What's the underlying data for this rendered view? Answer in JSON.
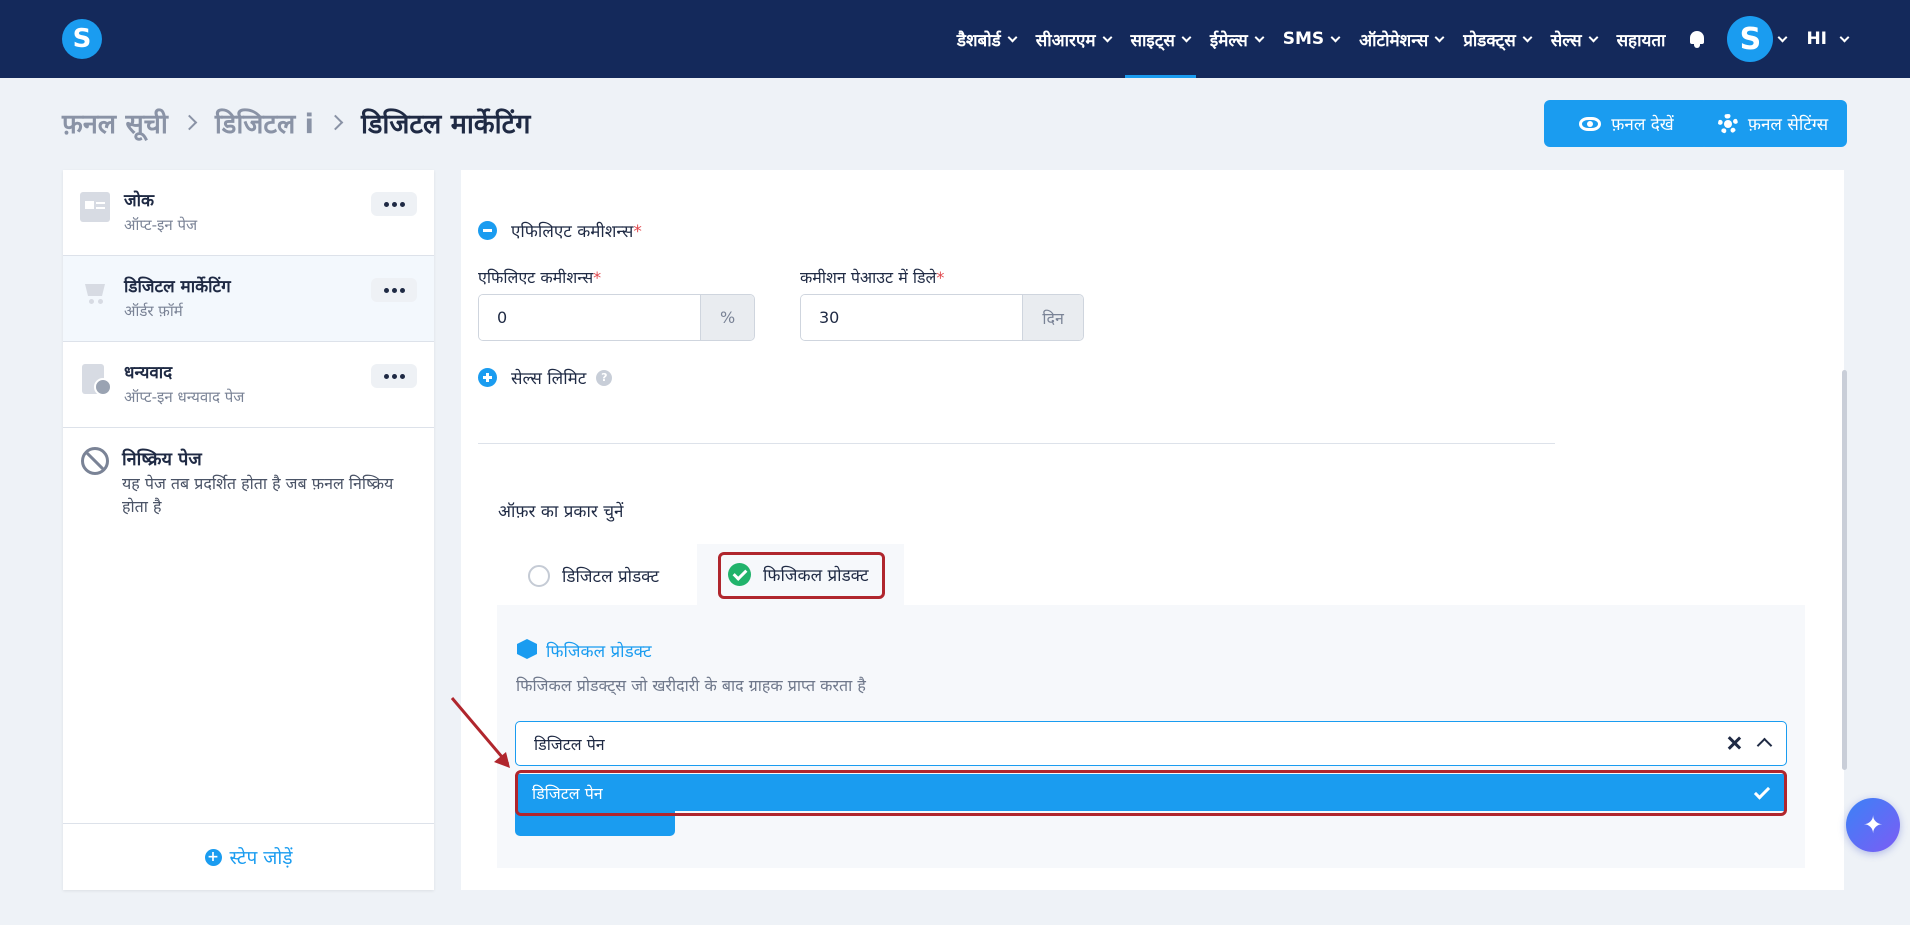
{
  "header": {
    "logo_letter": "S",
    "nav": [
      {
        "label": "डैशबोर्ड",
        "active": false
      },
      {
        "label": "सीआरएम",
        "active": false
      },
      {
        "label": "साइट्स",
        "active": true
      },
      {
        "label": "ईमेल्स",
        "active": false
      },
      {
        "label": "SMS",
        "active": false
      },
      {
        "label": "ऑटोमेशन्स",
        "active": false
      },
      {
        "label": "प्रोडक्ट्स",
        "active": false
      },
      {
        "label": "सेल्स",
        "active": false
      }
    ],
    "help_label": "सहायता",
    "avatar_letter": "S",
    "language": "HI"
  },
  "breadcrumb": {
    "funnel_list": "फ़नल सूची",
    "funnel": "डिजिटल i",
    "current": "डिजिटल मार्केटिंग"
  },
  "actions": {
    "view_funnel": "फ़नल देखें",
    "funnel_settings": "फ़नल सेटिंग्स"
  },
  "sidebar": {
    "steps": [
      {
        "title": "जोक",
        "subtitle": "ऑप्ट-इन पेज",
        "icon": "page-icon"
      },
      {
        "title": "डिजिटल मार्केटिंग",
        "subtitle": "ऑर्डर फ़ॉर्म",
        "icon": "cart-icon"
      },
      {
        "title": "धन्यवाद",
        "subtitle": "ऑप्ट-इन धन्यवाद पेज",
        "icon": "clipboard-check-icon"
      }
    ],
    "inactive": {
      "title": "निष्क्रिय पेज",
      "description": "यह पेज तब प्रदर्शित होता है जब फ़नल निष्क्रिय होता है"
    },
    "add_step": "स्टेप जोड़ें"
  },
  "main": {
    "affiliate_section": "एफिलिएट कमीशन्स",
    "affiliate_commission_label": "एफिलिएट कमीशन्स",
    "affiliate_commission_value": "0",
    "affiliate_commission_unit": "%",
    "payout_delay_label": "कमीशन पेआउट में डिले",
    "payout_delay_value": "30",
    "payout_delay_unit": "दिन",
    "sales_limit": "सेल्स लिमिट",
    "help_symbol": "?",
    "offer_type_label": "ऑफ़र का प्रकार चुनें",
    "offer_options": [
      "डिजिटल प्रोडक्ट",
      "फिजिकल प्रोडक्ट"
    ],
    "selected_offer": "फिजिकल प्रोडक्ट",
    "physical_title": "फिजिकल प्रोडक्ट",
    "physical_desc": "फिजिकल प्रोडक्ट्स जो खरीदारी के बाद ग्राहक प्राप्त करता है",
    "search_value": "डिजिटल पेन",
    "dropdown_options": [
      "डिजिटल पेन"
    ]
  },
  "colors": {
    "nav_bg": "#14295b",
    "accent": "#1a9cf0",
    "highlight": "#b0262d",
    "success": "#21b36b"
  }
}
